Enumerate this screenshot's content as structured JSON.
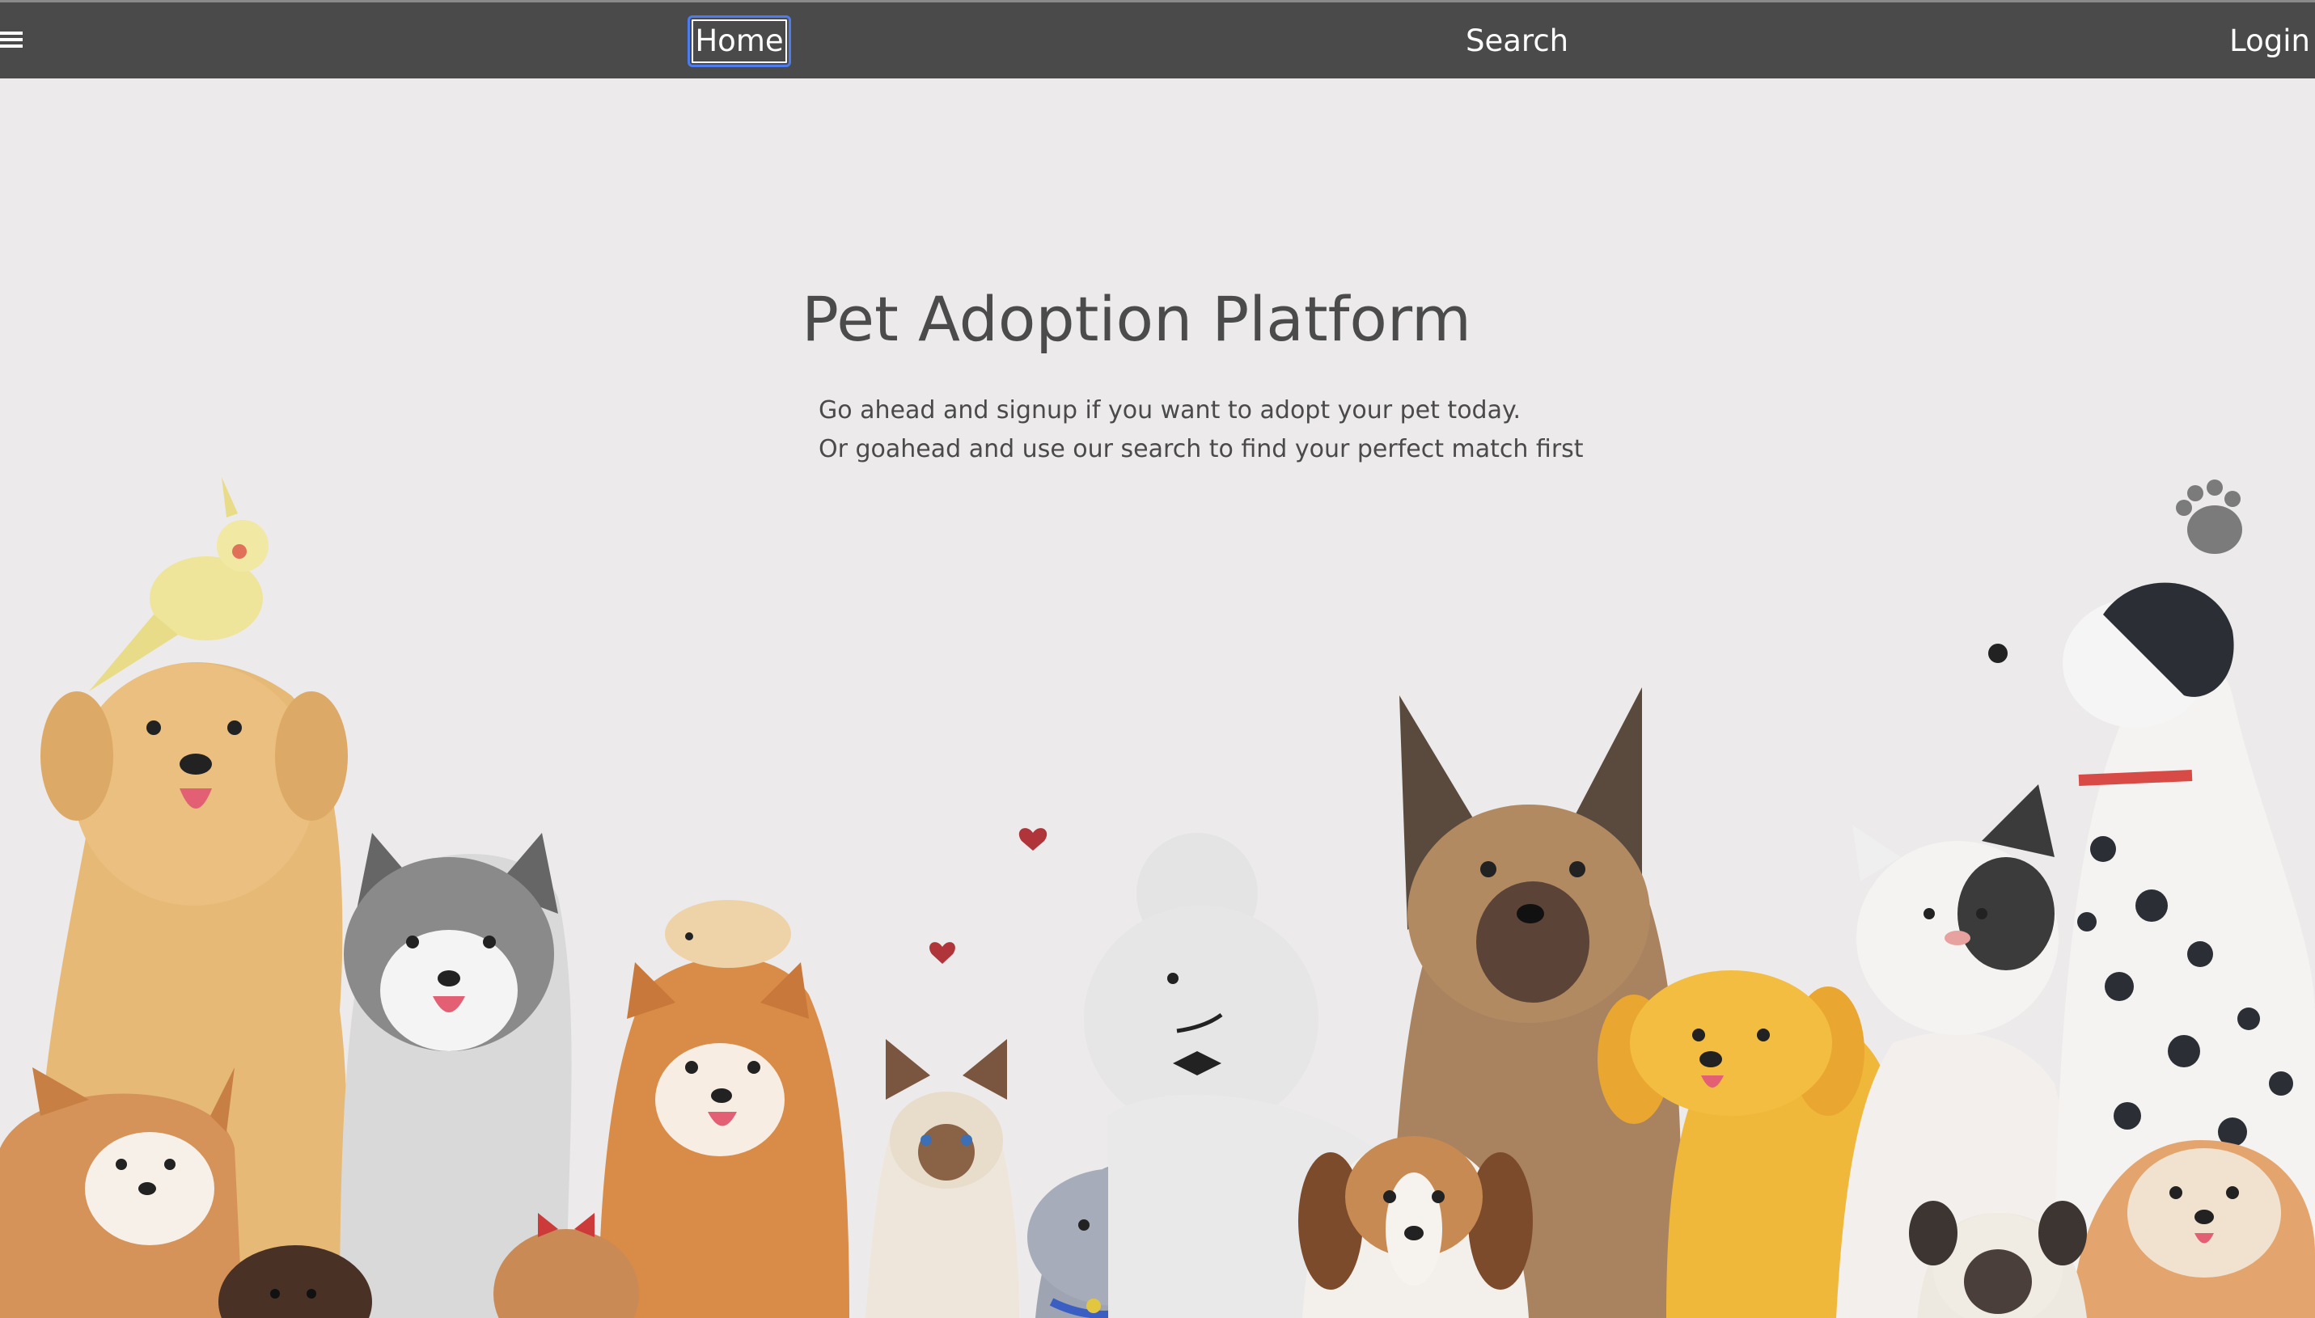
{
  "nav": {
    "menu_icon": "hamburger-icon",
    "home_label": "Home",
    "search_label": "Search",
    "login_label": "Login"
  },
  "hero": {
    "title": "Pet Adoption Platform",
    "line1": "Go ahead and signup if you want to adopt your pet today.",
    "line2": "Or goahead and use our search to find your perfect match first"
  },
  "colors": {
    "navbar": "#4a4a4a",
    "background": "#eceaea",
    "focus_ring": "#4c7cf0"
  }
}
